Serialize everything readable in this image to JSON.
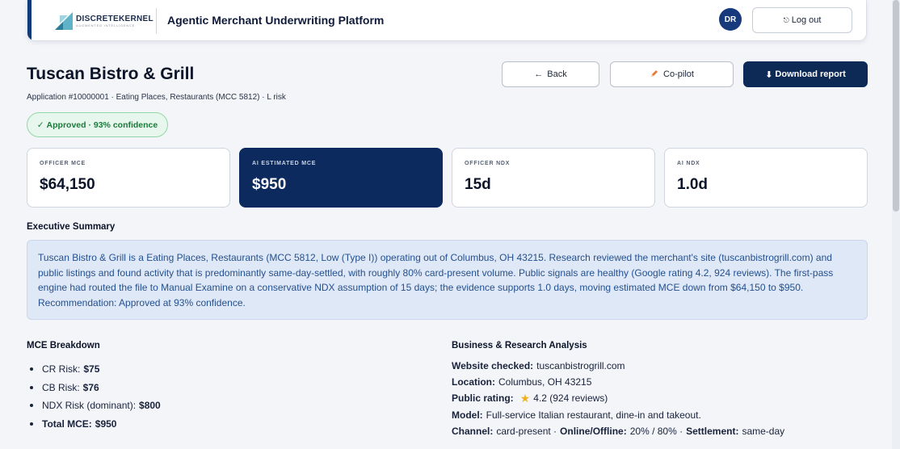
{
  "header": {
    "brand_name": "DISCRETEKERNEL",
    "brand_tagline": "AUGMENTED INTELLIGENCE",
    "title": "Agentic Merchant Underwriting Platform",
    "avatar_initials": "DR",
    "logout_label": "Log out",
    "logout_icon": "logout-icon"
  },
  "page": {
    "merchant_name": "Tuscan Bistro & Grill",
    "application_meta": "Application #10000001 · Eating Places, Restaurants (MCC 5812) · L risk",
    "back_label": "Back",
    "copilot_label": "Co-pilot",
    "download_label": "Download report",
    "status_badge": "Approved · 93% confidence"
  },
  "metrics": [
    {
      "label": "OFFICER MCE",
      "value": "$64,150"
    },
    {
      "label": "AI ESTIMATED MCE",
      "value": "$950"
    },
    {
      "label": "OFFICER NDX",
      "value": "15d"
    },
    {
      "label": "AI NDX",
      "value": "1.0d"
    }
  ],
  "summary": {
    "title": "Executive Summary",
    "text": "Tuscan Bistro & Grill is a Eating Places, Restaurants (MCC 5812, Low (Type I)) operating out of Columbus, OH 43215. Research reviewed the merchant's site (tuscanbistrogrill.com) and public listings and found activity that is predominantly same-day-settled, with roughly 80% card-present volume. Public signals are healthy (Google rating 4.2, 924 reviews). The first-pass engine had routed the file to Manual Examine on a conservative NDX assumption of 15 days; the evidence supports 1.0 days, moving estimated MCE down from $64,150 to $950. Recommendation: Approved at 93% confidence."
  },
  "mce_breakdown": {
    "title": "MCE Breakdown",
    "items": [
      {
        "label": "CR Risk:",
        "value": "$75"
      },
      {
        "label": "CB Risk:",
        "value": "$76"
      },
      {
        "label": "NDX Risk (dominant):",
        "value": "$800"
      },
      {
        "label": "Total MCE:",
        "value": "$950"
      }
    ]
  },
  "research": {
    "title": "Business & Research Analysis",
    "website_label": "Website checked:",
    "website_value": "tuscanbistrogrill.com",
    "location_label": "Location:",
    "location_value": "Columbus, OH 43215",
    "rating_label": "Public rating:",
    "rating_value": "4.2 (924 reviews)",
    "model_label": "Model:",
    "model_value": "Full-service Italian restaurant, dine-in and takeout.",
    "channel_label": "Channel:",
    "channel_value": "card-present ·",
    "online_label": "Online/Offline:",
    "online_value": "20% / 80% ·",
    "settlement_label": "Settlement:",
    "settlement_value": "same-day"
  },
  "colors": {
    "primary": "#0d2a57",
    "success": "#1a7a3a",
    "summary_text": "#24508f",
    "star": "#f2b01e"
  }
}
